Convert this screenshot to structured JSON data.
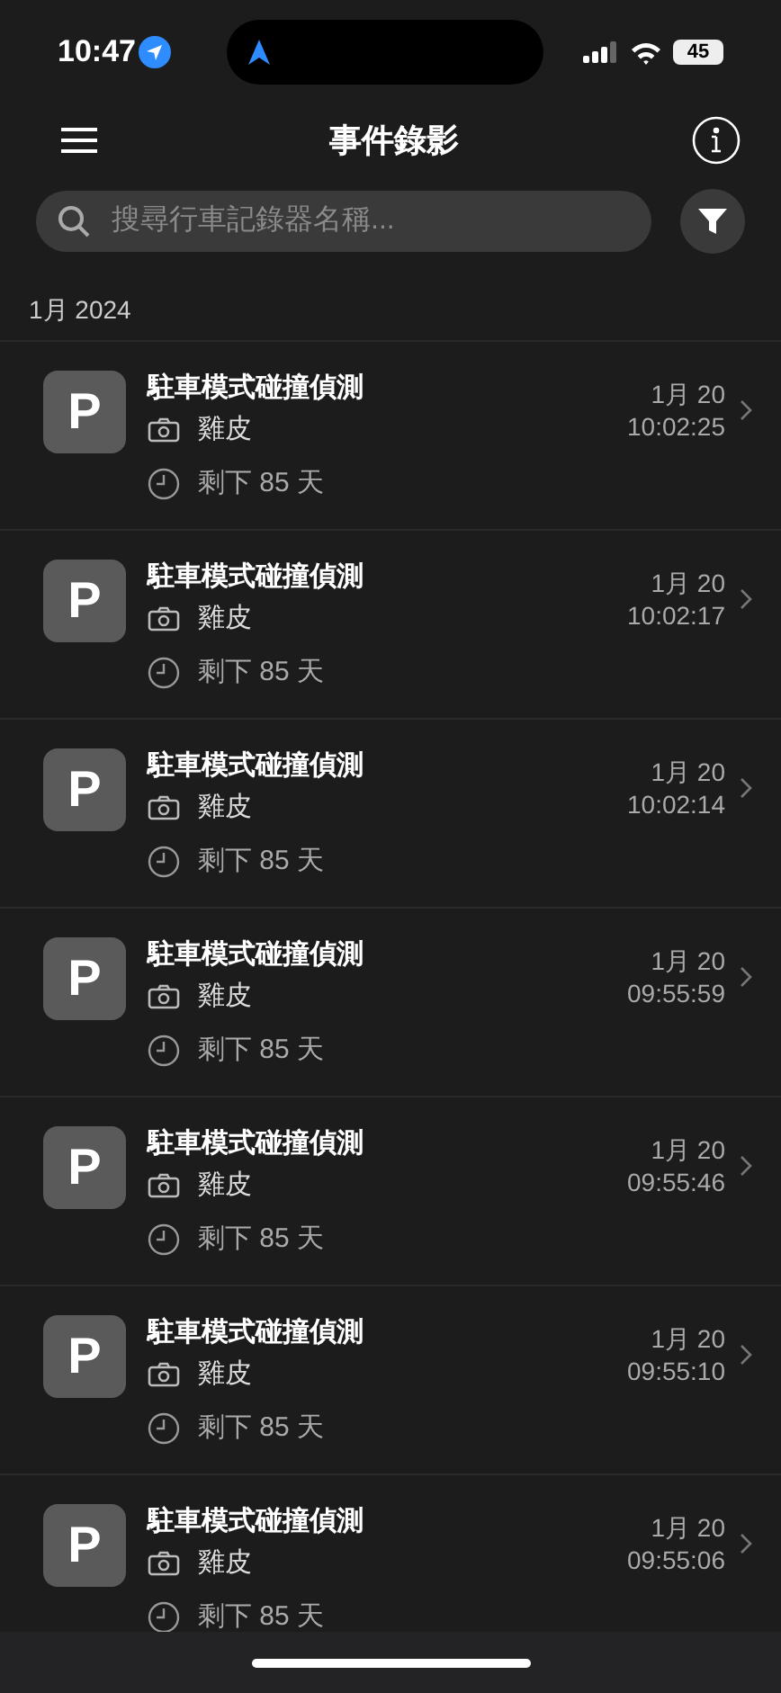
{
  "status_bar": {
    "time": "10:47",
    "battery": "45"
  },
  "header": {
    "title": "事件錄影"
  },
  "search": {
    "placeholder": "搜尋行車記錄器名稱..."
  },
  "section": {
    "label": "1月 2024"
  },
  "events": [
    {
      "badge": "P",
      "title": "駐車模式碰撞偵測",
      "camera": "雞皮",
      "retention": "剩下 85 天",
      "date": "1月 20",
      "time": "10:02:25"
    },
    {
      "badge": "P",
      "title": "駐車模式碰撞偵測",
      "camera": "雞皮",
      "retention": "剩下 85 天",
      "date": "1月 20",
      "time": "10:02:17"
    },
    {
      "badge": "P",
      "title": "駐車模式碰撞偵測",
      "camera": "雞皮",
      "retention": "剩下 85 天",
      "date": "1月 20",
      "time": "10:02:14"
    },
    {
      "badge": "P",
      "title": "駐車模式碰撞偵測",
      "camera": "雞皮",
      "retention": "剩下 85 天",
      "date": "1月 20",
      "time": "09:55:59"
    },
    {
      "badge": "P",
      "title": "駐車模式碰撞偵測",
      "camera": "雞皮",
      "retention": "剩下 85 天",
      "date": "1月 20",
      "time": "09:55:46"
    },
    {
      "badge": "P",
      "title": "駐車模式碰撞偵測",
      "camera": "雞皮",
      "retention": "剩下 85 天",
      "date": "1月 20",
      "time": "09:55:10"
    },
    {
      "badge": "P",
      "title": "駐車模式碰撞偵測",
      "camera": "雞皮",
      "retention": "剩下 85 天",
      "date": "1月 20",
      "time": "09:55:06"
    }
  ]
}
